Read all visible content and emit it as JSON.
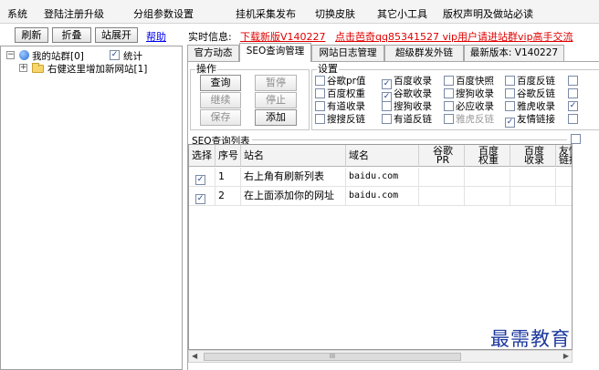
{
  "menu": [
    "系统",
    "登陆注册升级",
    "分组参数设置",
    "挂机采集发布",
    "切换皮肤",
    "其它小工具",
    "版权声明及做站必读"
  ],
  "toolbar": {
    "refresh": "刷新",
    "fold": "折叠",
    "expand": "站展开",
    "help": "帮助"
  },
  "tree": {
    "root_label": "我的站群[0]",
    "stats_label": "统计",
    "stats_checked": true,
    "child_label": "右健这里增加新网站[1]"
  },
  "info": {
    "label": "实时信息:",
    "download": "下载新版V140227",
    "promo": "点击芭奇qq85341527 vip用户请进站群vip高手交流"
  },
  "tabs": [
    "官方动态",
    "SEO查询管理",
    "网站日志管理",
    "超级群发外链",
    "最新版本: V140227"
  ],
  "active_tab": 1,
  "ops": {
    "title": "操作",
    "query": "查询",
    "pause": "暂停",
    "continue": "继续",
    "stop": "停止",
    "save": "保存",
    "add": "添加"
  },
  "settings": {
    "title": "设置",
    "options": [
      {
        "label": "谷歌pr值",
        "checked": false,
        "disabled": false
      },
      {
        "label": "百度收录",
        "checked": true,
        "disabled": false
      },
      {
        "label": "百度快照",
        "checked": false,
        "disabled": false
      },
      {
        "label": "百度反链",
        "checked": false,
        "disabled": false
      },
      {
        "label": "百度权重",
        "checked": false,
        "disabled": false
      },
      {
        "label": "谷歌收录",
        "checked": true,
        "disabled": false
      },
      {
        "label": "搜狗收录",
        "checked": false,
        "disabled": false
      },
      {
        "label": "谷歌反链",
        "checked": false,
        "disabled": false
      },
      {
        "label": "有道收录",
        "checked": false,
        "disabled": false
      },
      {
        "label": "搜狗收录",
        "checked": false,
        "disabled": false
      },
      {
        "label": "必应收录",
        "checked": false,
        "disabled": false
      },
      {
        "label": "雅虎收录",
        "checked": false,
        "disabled": false
      },
      {
        "label": "搜搜反链",
        "checked": false,
        "disabled": false
      },
      {
        "label": "有道反链",
        "checked": false,
        "disabled": false
      },
      {
        "label": "雅虎反链",
        "checked": false,
        "disabled": true
      },
      {
        "label": "友情链接",
        "checked": true,
        "disabled": false
      }
    ]
  },
  "list": {
    "title": "SEO查询列表",
    "columns": [
      "选择",
      "序号",
      "站名",
      "域名",
      "谷歌\nPR",
      "百度\n权重",
      "百度\n收录",
      "友情\n链接"
    ],
    "rows": [
      {
        "checked": true,
        "no": "1",
        "name": "右上角有刷新列表",
        "domain": "baidu.com"
      },
      {
        "checked": true,
        "no": "2",
        "name": "在上面添加你的网址",
        "domain": "baidu.com"
      }
    ]
  },
  "scrollbar": {
    "thumb_glyph": "III",
    "left": "◀",
    "right": "▶"
  },
  "watermark": "最需教育"
}
